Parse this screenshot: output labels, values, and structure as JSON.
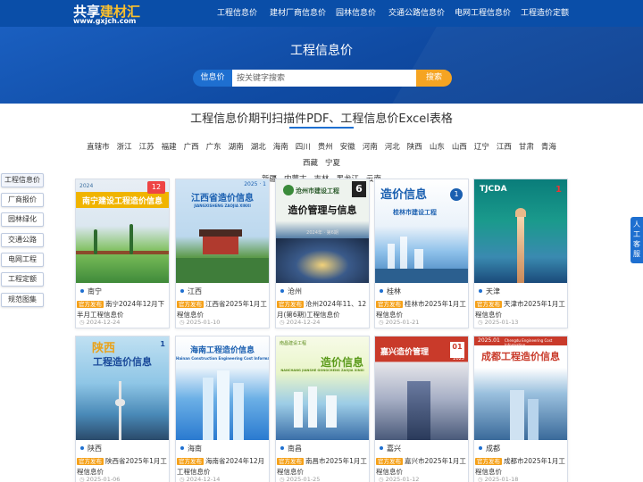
{
  "brand": {
    "name_left": "共享",
    "name_right": "建材汇",
    "url": "www.gxjch.com"
  },
  "nav": {
    "items": [
      "工程信息价",
      "建材厂商信息价",
      "园林信息价",
      "交通公路信息价",
      "电网工程信息价",
      "工程造价定额"
    ]
  },
  "banner": {
    "title": "工程信息价",
    "search_label": "信息价",
    "search_placeholder": "按关键字搜索",
    "search_button": "搜索"
  },
  "section": {
    "title": "工程信息价期刊扫描件PDF、工程信息价Excel表格"
  },
  "cities": [
    "直辖市",
    "浙江",
    "江苏",
    "福建",
    "广西",
    "广东",
    "湖南",
    "湖北",
    "海南",
    "四川",
    "贵州",
    "安徽",
    "河南",
    "河北",
    "陕西",
    "山东",
    "山西",
    "辽宁",
    "江西",
    "甘肃",
    "青海",
    "西藏",
    "宁夏",
    "新疆",
    "内蒙古",
    "吉林",
    "黑龙江",
    "云南"
  ],
  "sidebar": {
    "items": [
      "工程信息价",
      "厂商报价",
      "园林绿化",
      "交通公路",
      "电网工程",
      "工程定额",
      "规范图集"
    ]
  },
  "service": {
    "label": "人工客服"
  },
  "badge_label": "官方发布",
  "cards": [
    {
      "city": "南宁",
      "desc": "南宁2024年12月下半月工程信息价",
      "date": "2024-12-24",
      "cover_title": "南宁建设工程造价信息",
      "cover_issue": "12",
      "cover_year": "2024"
    },
    {
      "city": "江西",
      "desc": "江西省2025年1月工程信息价",
      "date": "2025-01-10",
      "cover_title": "江西省造价信息",
      "cover_sub": "JIANGXISHENG ZAOJIA XINXI",
      "cover_issue": "2025 · 1"
    },
    {
      "city": "沧州",
      "desc": "沧州2024年11、12月(第6期)工程信息价",
      "date": "2024-12-24",
      "cover_title": "造价管理与信息",
      "cover_header": "沧州市建设工程",
      "cover_issue": "6",
      "cover_footer": "2024年 · 第6期"
    },
    {
      "city": "桂林",
      "desc": "桂林市2025年1月工程信息价",
      "date": "2025-01-21",
      "cover_title": "造价信息",
      "cover_sub": "桂林市建设工程",
      "cover_issue": "1"
    },
    {
      "city": "天津",
      "desc": "天津市2025年1月工程信息价",
      "date": "2025-01-13",
      "cover_title": "TJCDA",
      "cover_issue": "1"
    },
    {
      "city": "陕西",
      "desc": "陕西省2025年1月工程信息价",
      "date": "2025-01-06",
      "cover_title": "工程造价信息",
      "cover_top": "陕西",
      "cover_issue": "1"
    },
    {
      "city": "海南",
      "desc": "海南省2024年12月工程信息价",
      "date": "2024-12-14",
      "cover_title": "海南工程造价信息",
      "cover_sub": "Hainan Construction Engineering Cost Information"
    },
    {
      "city": "南昌",
      "desc": "南昌市2025年1月工程信息价",
      "date": "2025-01-25",
      "cover_title": "造价信息",
      "cover_small": "南昌建设工程",
      "cover_sub": "NANCHANG JIANSHE GONGCHENG ZAOJIA XINXI"
    },
    {
      "city": "嘉兴",
      "desc": "嘉兴市2025年1月工程信息价",
      "date": "2025-01-12",
      "cover_title": "嘉兴造价管理",
      "cover_issue": "01",
      "cover_year": "2025"
    },
    {
      "city": "成都",
      "desc": "成都市2025年1月工程信息价",
      "date": "2025-01-18",
      "cover_title": "成都工程造价信息",
      "cover_top": "2025.01",
      "cover_sub": "Chengdu Engineering Cost Information"
    }
  ],
  "colors": {
    "primary": "#0a4ea8",
    "accent": "#f5a11a",
    "link_blue": "#1e6fd0"
  }
}
